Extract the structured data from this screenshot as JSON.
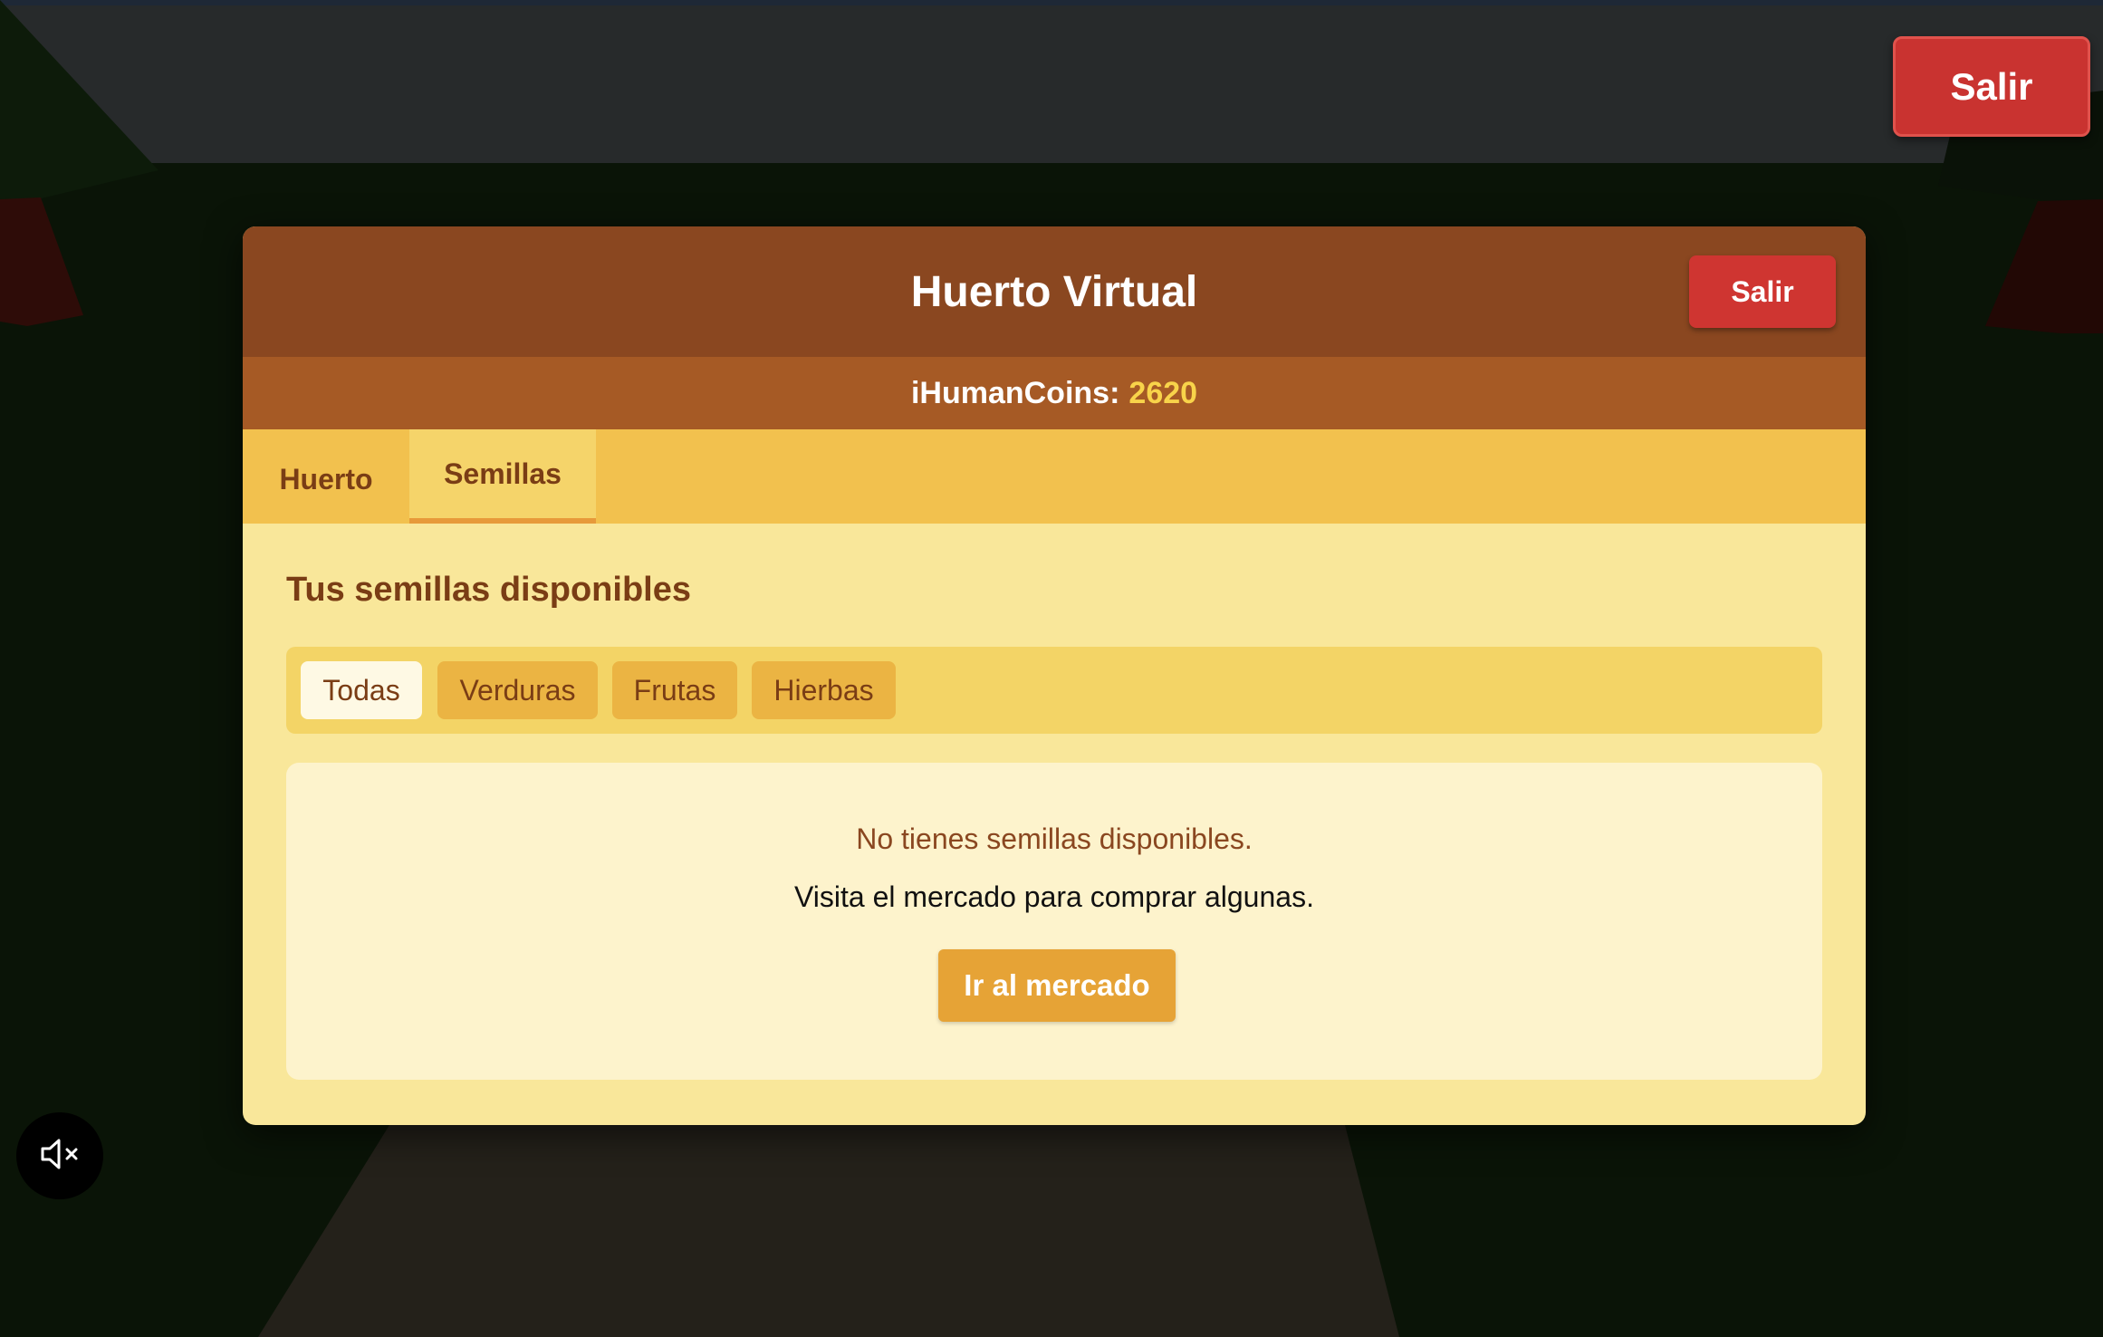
{
  "exit_top_label": "Salir",
  "modal": {
    "title": "Huerto Virtual",
    "exit_label": "Salir",
    "coins_label": "iHumanCoins:",
    "coins_value": "2620"
  },
  "tabs": [
    {
      "label": "Huerto",
      "active": false
    },
    {
      "label": "Semillas",
      "active": true
    }
  ],
  "seeds": {
    "title": "Tus semillas disponibles",
    "filters": [
      {
        "label": "Todas",
        "active": true
      },
      {
        "label": "Verduras",
        "active": false
      },
      {
        "label": "Frutas",
        "active": false
      },
      {
        "label": "Hierbas",
        "active": false
      }
    ],
    "empty_message": "No tienes semillas disponibles.",
    "empty_hint": "Visita el mercado para comprar algunas.",
    "market_button": "Ir al mercado"
  },
  "audio": {
    "muted": true,
    "icon": "speaker-muted-icon"
  },
  "colors": {
    "header": "#8a4720",
    "coins_bar": "#a65a25",
    "tabs_bar": "#f2c14e",
    "panel": "#f9e79a",
    "exit_red": "#c93330",
    "coins_value": "#f8d34a",
    "market_button": "#e6a336"
  }
}
